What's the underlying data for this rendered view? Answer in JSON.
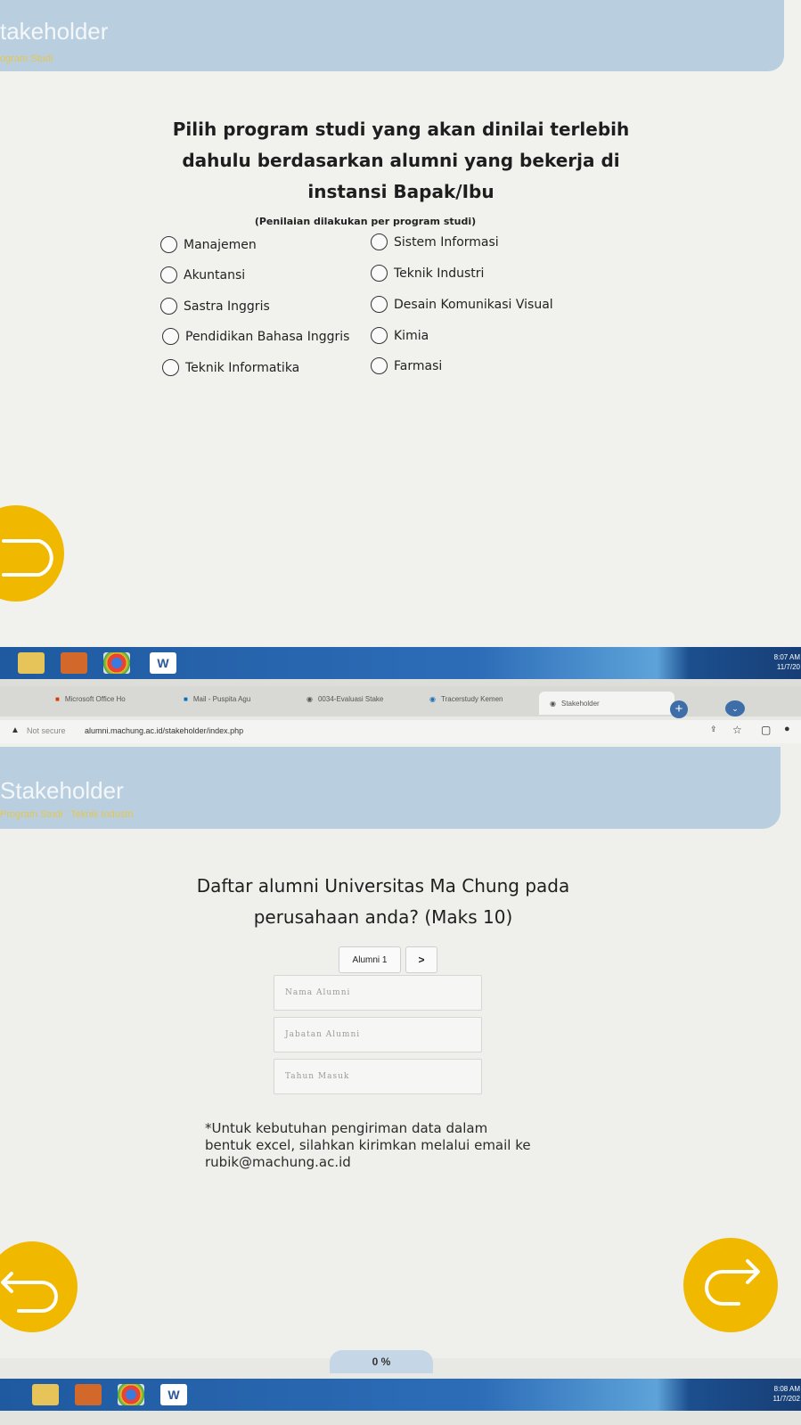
{
  "top_page": {
    "header": {
      "title": "takeholder",
      "subtitle": "ogram Studi"
    },
    "question": {
      "line1": "Pilih program studi yang akan dinilai terlebih",
      "line2": "dahulu berdasarkan alumni yang bekerja di",
      "line3": "instansi Bapak/Ibu",
      "note": "(Penilaian dilakukan per program studi)"
    },
    "options_left": [
      "Manajemen",
      "Akuntansi",
      "Sastra Inggris",
      "Pendidikan Bahasa Inggris",
      "Teknik Informatika"
    ],
    "options_right": [
      "Sistem Informasi",
      "Teknik Industri",
      "Desain Komunikasi Visual",
      "Kimia",
      "Farmasi"
    ],
    "back_icon": "back-arrow-icon"
  },
  "taskbar1": {
    "time": "8:07 AM",
    "date": "11/7/20"
  },
  "browser": {
    "tabs": [
      "Microsoft Office Ho",
      "Mail - Puspita Agu",
      "0034-Evaluasi Stake",
      "Tracerstudy Kemen",
      "Stakeholder"
    ],
    "security": "Not secure",
    "url": "alumni.machung.ac.id/stakeholder/index.php"
  },
  "bottom_page": {
    "header": {
      "title": "Stakeholder",
      "subtitle": "Program Studi : Teknik Industri"
    },
    "question": {
      "line1": "Daftar alumni Universitas Ma Chung pada",
      "line2": "perusahaan anda? (Maks 10)"
    },
    "alumni_tab": "Alumni 1",
    "next_label": ">",
    "fields": {
      "name": "Nama Alumni",
      "position": "Jabatan Alumni",
      "year": "Tahun Masuk"
    },
    "note": {
      "line1": "*Untuk kebutuhan pengiriman data dalam",
      "line2": "bentuk excel, silahkan kirimkan melalui email ke",
      "line3": "rubik@machung.ac.id"
    },
    "progress": "0 %"
  },
  "taskbar2": {
    "time": "8:08 AM",
    "date": "11/7/202"
  },
  "colors": {
    "accent": "#f1b800",
    "header": "#b9cfe0",
    "taskbar": "#2d6db8"
  }
}
